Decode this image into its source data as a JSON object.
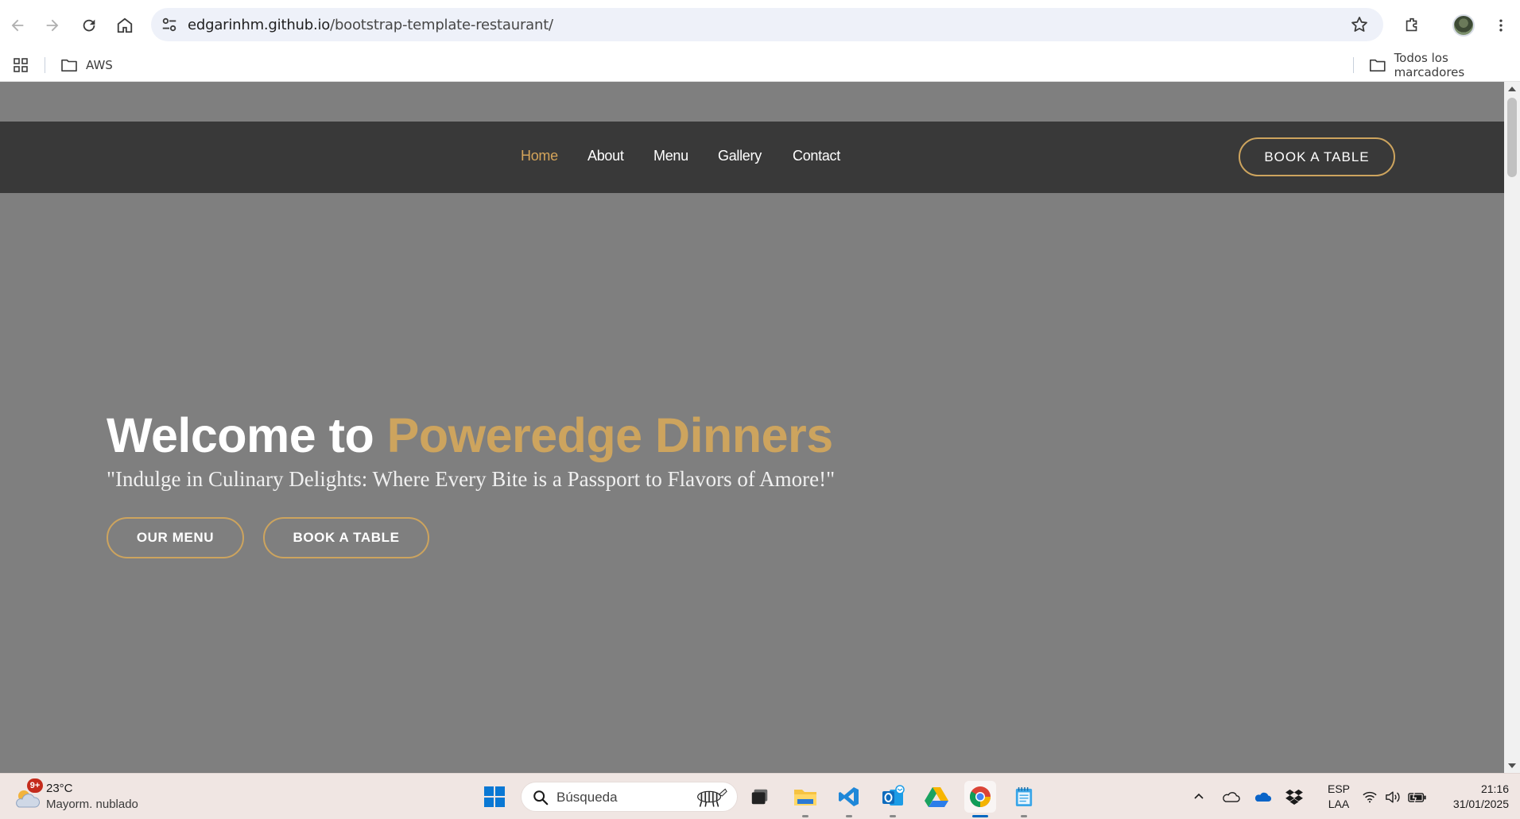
{
  "browser": {
    "url_host": "edgarinhm.github.io",
    "url_path": "/bootstrap-template-restaurant/",
    "bookmarks": [
      {
        "label": "AWS"
      }
    ],
    "all_bookmarks_label": "Todos los marcadores"
  },
  "site": {
    "nav": [
      {
        "label": "Home",
        "active": true
      },
      {
        "label": "About",
        "active": false
      },
      {
        "label": "Menu",
        "active": false
      },
      {
        "label": "Gallery",
        "active": false
      },
      {
        "label": "Contact",
        "active": false
      }
    ],
    "header_cta": "BOOK A TABLE",
    "hero": {
      "title_prefix": "Welcome to ",
      "title_brand": "Poweredge Dinners",
      "subtitle": "\"Indulge in Culinary Delights: Where Every Bite is a Passport to Flavors of Amore!\"",
      "btn_menu": "OUR MENU",
      "btn_book": "BOOK A TABLE"
    },
    "colors": {
      "accent": "#cda45e",
      "header_bg": "#393939",
      "page_bg": "#7f7f7f"
    }
  },
  "taskbar": {
    "weather_badge": "9+",
    "weather_temp": "23°C",
    "weather_desc": "Mayorm. nublado",
    "search_placeholder": "Búsqueda",
    "lang_line1": "ESP",
    "lang_line2": "LAA",
    "time": "21:16",
    "date": "31/01/2025"
  }
}
